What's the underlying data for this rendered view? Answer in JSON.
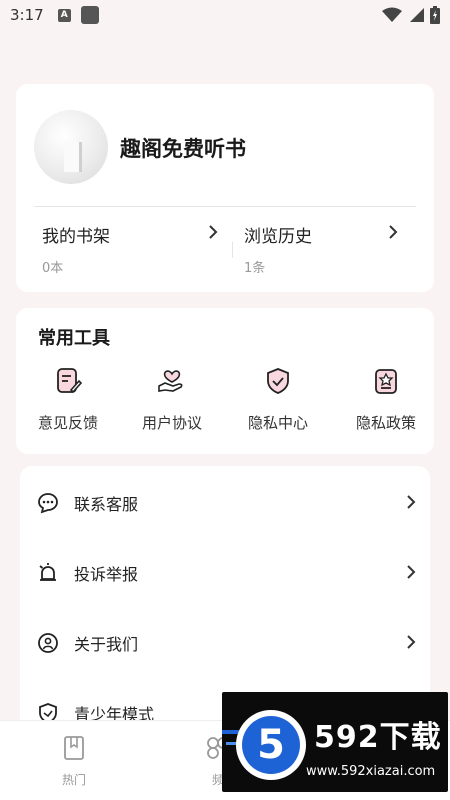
{
  "status_bar": {
    "time": "3:17",
    "badge": "A"
  },
  "profile": {
    "name": "趣阁免费听书",
    "bookshelf_label": "我的书架",
    "bookshelf_count": "0本",
    "history_label": "浏览历史",
    "history_count": "1条",
    "chevron": "›"
  },
  "tools": {
    "title": "常用工具",
    "items": [
      {
        "label": "意见反馈",
        "icon": "feedback-icon"
      },
      {
        "label": "用户协议",
        "icon": "agreement-icon"
      },
      {
        "label": "隐私中心",
        "icon": "shield-icon"
      },
      {
        "label": "隐私政策",
        "icon": "policy-icon"
      }
    ]
  },
  "menu": {
    "items": [
      {
        "label": "联系客服",
        "icon": "chat-icon"
      },
      {
        "label": "投诉举报",
        "icon": "alarm-icon"
      },
      {
        "label": "关于我们",
        "icon": "info-icon"
      },
      {
        "label": "青少年模式",
        "icon": "youth-shield-icon"
      }
    ],
    "chevron": "›"
  },
  "bottom_nav": {
    "items": [
      {
        "label": "热门",
        "icon": "bookmark-icon"
      },
      {
        "label": "频",
        "icon": "category-icon"
      }
    ]
  },
  "watermark": {
    "digit": "5",
    "title": "592下载",
    "url": "www.592xiazai.com"
  },
  "colors": {
    "accent": "#c7324d",
    "background": "#faf3f4",
    "card": "#ffffff"
  }
}
